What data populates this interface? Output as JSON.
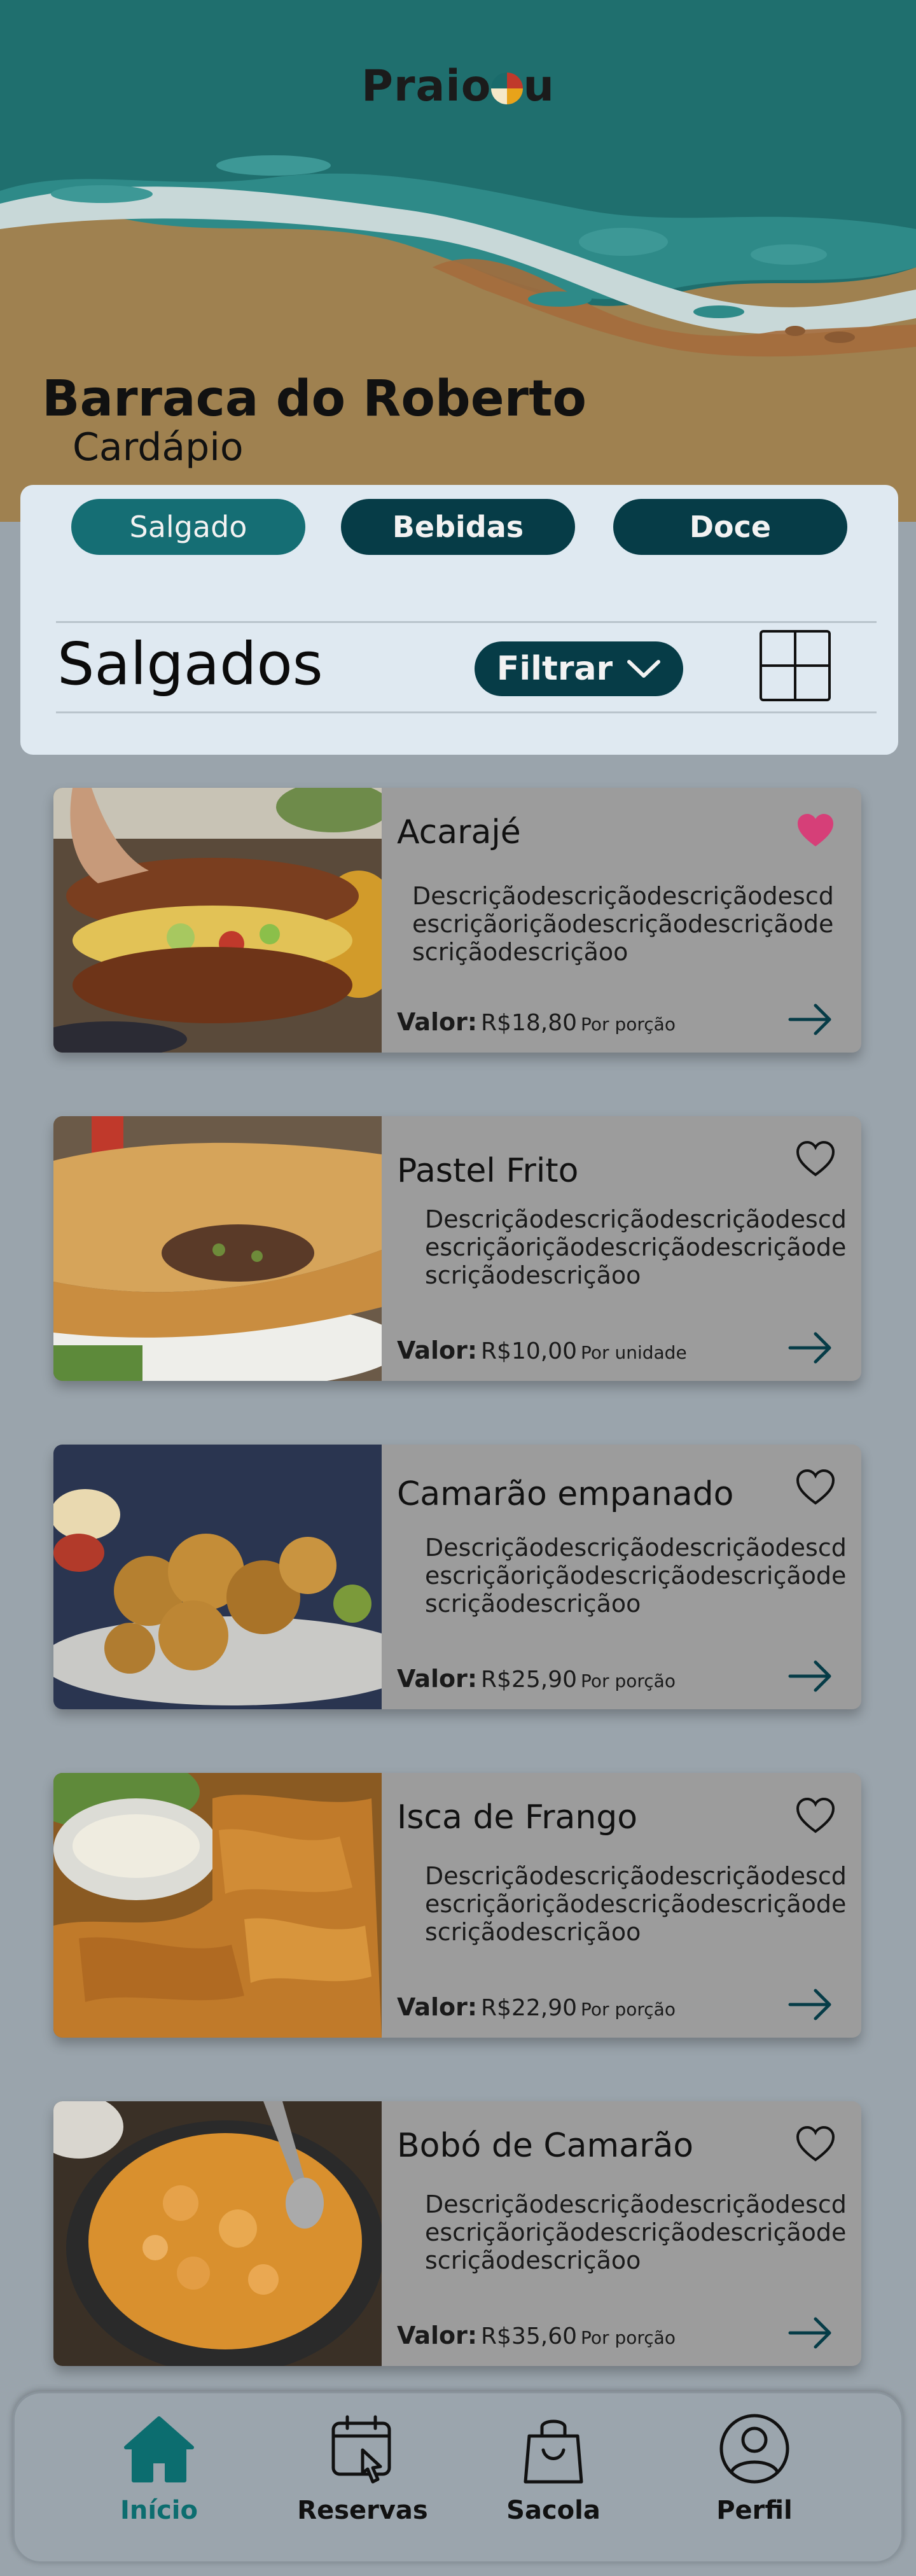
{
  "app": {
    "logo_text": "Praio",
    "logo_text_end": "u"
  },
  "store": {
    "name": "Barraca do Roberto",
    "subtitle": "Cardápio"
  },
  "categories": [
    {
      "label": "Salgado",
      "active": true
    },
    {
      "label": "Bebidas",
      "active": false
    },
    {
      "label": "Doce",
      "active": false
    }
  ],
  "section": {
    "title": "Salgados",
    "filter_label": "Filtrar"
  },
  "items": [
    {
      "name": "Acarajé",
      "description": "Descriçãodescriçãodescriçãodescdescriçãoriçãodescriçãodescriçãodescriçãodescriçãoo",
      "value_label": "Valor:",
      "price": "R$18,80",
      "unit": "Por porção",
      "favorite": true
    },
    {
      "name": "Pastel Frito",
      "description": "Descriçãodescriçãodescriçãodescdescriçãoriçãodescriçãodescriçãodescriçãodescriçãoo",
      "value_label": "Valor:",
      "price": "R$10,00",
      "unit": "Por unidade",
      "favorite": false
    },
    {
      "name": "Camarão empanado",
      "description": "Descriçãodescriçãodescriçãodescdescriçãoriçãodescriçãodescriçãodescriçãodescriçãoo",
      "value_label": "Valor:",
      "price": "R$25,90",
      "unit": "Por porção",
      "favorite": false
    },
    {
      "name": "Isca de Frango",
      "description": "Descriçãodescriçãodescriçãodescdescriçãoriçãodescriçãodescriçãodescriçãodescriçãoo",
      "value_label": "Valor:",
      "price": "R$22,90",
      "unit": "Por porção",
      "favorite": false
    },
    {
      "name": "Bobó de Camarão",
      "description": "Descriçãodescriçãodescriçãodescdescriçãoriçãodescriçãodescriçãodescriçãodescriçãoo",
      "value_label": "Valor:",
      "price": "R$35,60",
      "unit": "Por porção",
      "favorite": false
    }
  ],
  "nav": [
    {
      "label": "Início",
      "icon": "home-icon",
      "active": true
    },
    {
      "label": "Reservas",
      "icon": "calendar-touch-icon",
      "active": false
    },
    {
      "label": "Sacola",
      "icon": "shopping-bag-icon",
      "active": false
    },
    {
      "label": "Perfil",
      "icon": "user-icon",
      "active": false
    }
  ],
  "colors": {
    "accent": "#156e74",
    "dark": "#063c47",
    "heart": "#d63f78",
    "background": "#9aa4ac"
  }
}
